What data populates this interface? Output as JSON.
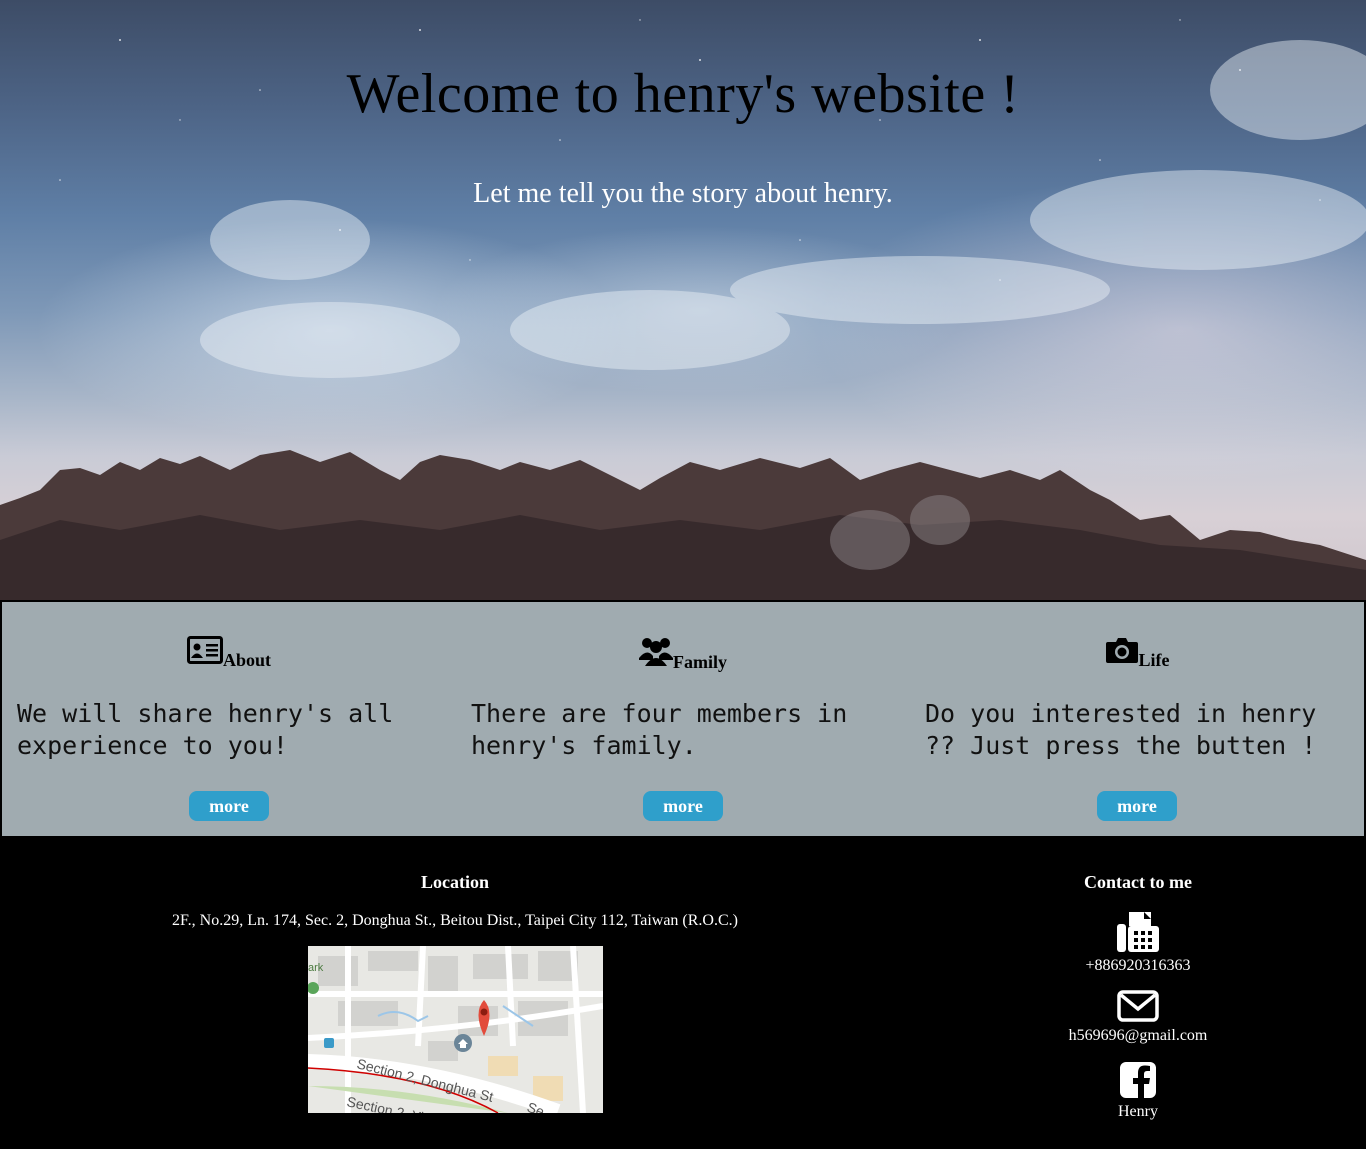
{
  "hero": {
    "title": "Welcome to henry's website !",
    "subtitle": "Let me tell you the story about henry."
  },
  "features": [
    {
      "icon": "id-card-icon",
      "title": "About",
      "text": "We will share henry's all experience to you!",
      "button": "more"
    },
    {
      "icon": "users-icon",
      "title": "Family",
      "text": "There are four members in henry's family.",
      "button": "more"
    },
    {
      "icon": "camera-icon",
      "title": "Life",
      "text": "Do you interested in henry ?? Just press the butten !",
      "button": "more"
    }
  ],
  "footer": {
    "location_title": "Location",
    "address": "2F., No.29, Ln. 174, Sec. 2, Donghua St., Beitou Dist., Taipei City 112, Taiwan (R.O.C.)",
    "map": {
      "street_label_1": "Section 2, Donghua St",
      "street_label_2": "Section 2, Yi",
      "park_label": "ark",
      "se_label": "Se"
    },
    "contact_title": "Contact to me",
    "phone": "+886920316363",
    "email": "h569696@gmail.com",
    "facebook": "Henry"
  },
  "colors": {
    "features_bg": "#a0abb0",
    "button_bg": "#2f9fcb",
    "footer_bg": "#000000"
  }
}
